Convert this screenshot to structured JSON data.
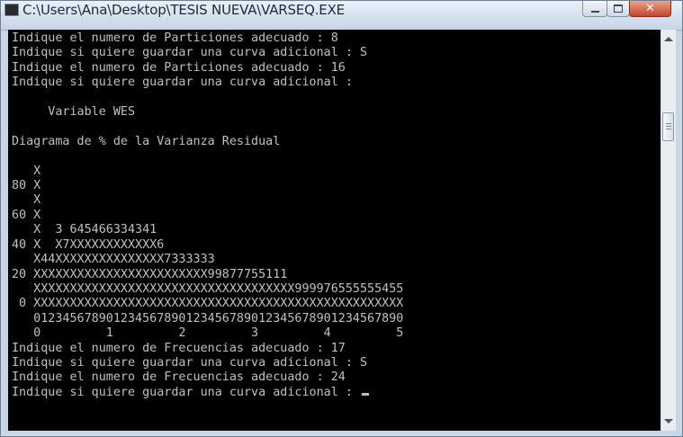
{
  "window": {
    "title": "C:\\Users\\Ana\\Desktop\\TESIS NUEVA\\VARSEQ.EXE"
  },
  "controls": {
    "close_glyph": "✕"
  },
  "console": {
    "lines": [
      "Indique el numero de Particiones adecuado : 8",
      "Indique si quiere guardar una curva adicional : S",
      "Indique el numero de Particiones adecuado : 16",
      "Indique si quiere guardar una curva adicional :",
      "",
      "     Variable WES",
      "",
      "Diagrama de % de la Varianza Residual",
      "",
      "   X",
      "80 X",
      "   X",
      "60 X",
      "   X  3 645466334341",
      "40 X  X7XXXXXXXXXXXX6",
      "   X44XXXXXXXXXXXXXXX7333333",
      "20 XXXXXXXXXXXXXXXXXXXXXXXX99877755111",
      "   XXXXXXXXXXXXXXXXXXXXXXXXXXXXXXXXXXXX999976555555455",
      " 0 XXXXXXXXXXXXXXXXXXXXXXXXXXXXXXXXXXXXXXXXXXXXXXXXXXX",
      "   0123456789012345678901234567890123456789012345678​90",
      "   0         1         2         3         4         5",
      "Indique el numero de Frecuencias adecuado : 17",
      "Indique si quiere guardar una curva adicional : S",
      "Indique el numero de Frecuencias adecuado : 24"
    ],
    "prompt_line": "Indique si quiere guardar una curva adicional : "
  }
}
